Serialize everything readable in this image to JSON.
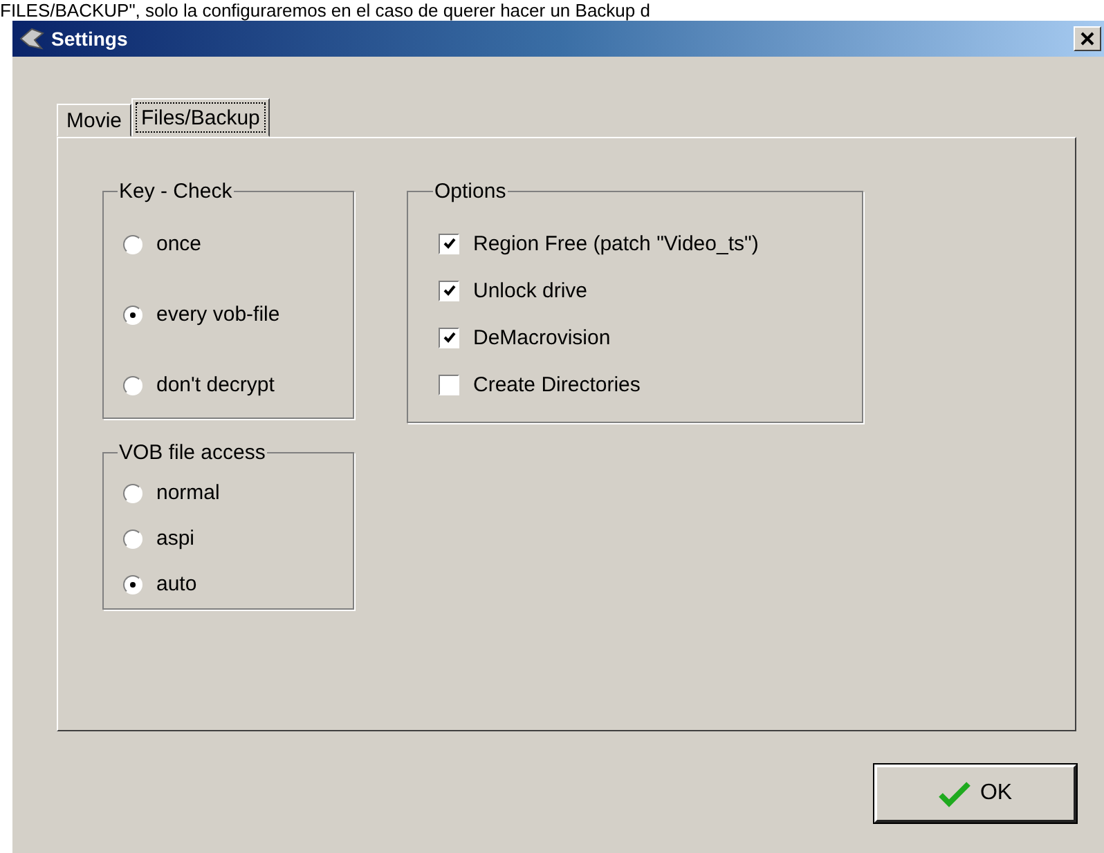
{
  "caption": "FILES/BACKUP\", solo la configuraremos en el caso de querer hacer un Backup d",
  "window": {
    "title": "Settings"
  },
  "tabs": [
    {
      "label": "Movie",
      "selected": false
    },
    {
      "label": "Files/Backup",
      "selected": true
    }
  ],
  "key_check": {
    "title": "Key - Check",
    "options": [
      {
        "label": "once",
        "selected": false
      },
      {
        "label": "every vob-file",
        "selected": true
      },
      {
        "label": "don't decrypt",
        "selected": false
      }
    ]
  },
  "vob_file_access": {
    "title": "VOB file access",
    "options": [
      {
        "label": "normal",
        "selected": false
      },
      {
        "label": "aspi",
        "selected": false
      },
      {
        "label": "auto",
        "selected": true
      }
    ]
  },
  "options": {
    "title": "Options",
    "items": [
      {
        "label": "Region Free  (patch \"Video_ts\")",
        "checked": true
      },
      {
        "label": "Unlock drive",
        "checked": true
      },
      {
        "label": "DeMacrovision",
        "checked": true
      },
      {
        "label": "Create Directories",
        "checked": false
      }
    ]
  },
  "buttons": [
    {
      "label": "OK"
    }
  ]
}
